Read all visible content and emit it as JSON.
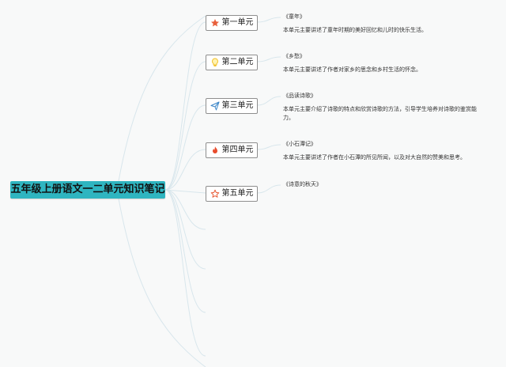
{
  "root": {
    "title": "五年级上册语文一二单元知识笔记"
  },
  "units": [
    {
      "label": "第一单元",
      "icon": "star-filled-icon",
      "book": "《童年》",
      "description": "本单元主要讲述了童年时期的美好回忆和儿时的快乐生活。"
    },
    {
      "label": "第二单元",
      "icon": "lightbulb-icon",
      "book": "《乡愁》",
      "description": "本单元主要讲述了作者对家乡的思念和乡村生活的怀念。"
    },
    {
      "label": "第三单元",
      "icon": "paper-plane-icon",
      "book": "《品读诗歌》",
      "description": "本单元主要介绍了诗歌的特点和欣赏诗歌的方法，引导学生培养对诗歌的鉴赏能力。"
    },
    {
      "label": "第四单元",
      "icon": "flame-icon",
      "book": "《小石潭记》",
      "description": "本单元主要讲述了作者在小石潭的所见所闻，以及对大自然的赞美和思考。"
    },
    {
      "label": "第五单元",
      "icon": "star-outline-icon",
      "book": "《诗意的秋天》",
      "description": ""
    }
  ],
  "colors": {
    "root_background": "#2fb5c0",
    "link": "#d8e6ec",
    "star": "#e8603c",
    "bulb": "#f2c230",
    "plane": "#3b86c8",
    "flame": "#e84b2c"
  }
}
